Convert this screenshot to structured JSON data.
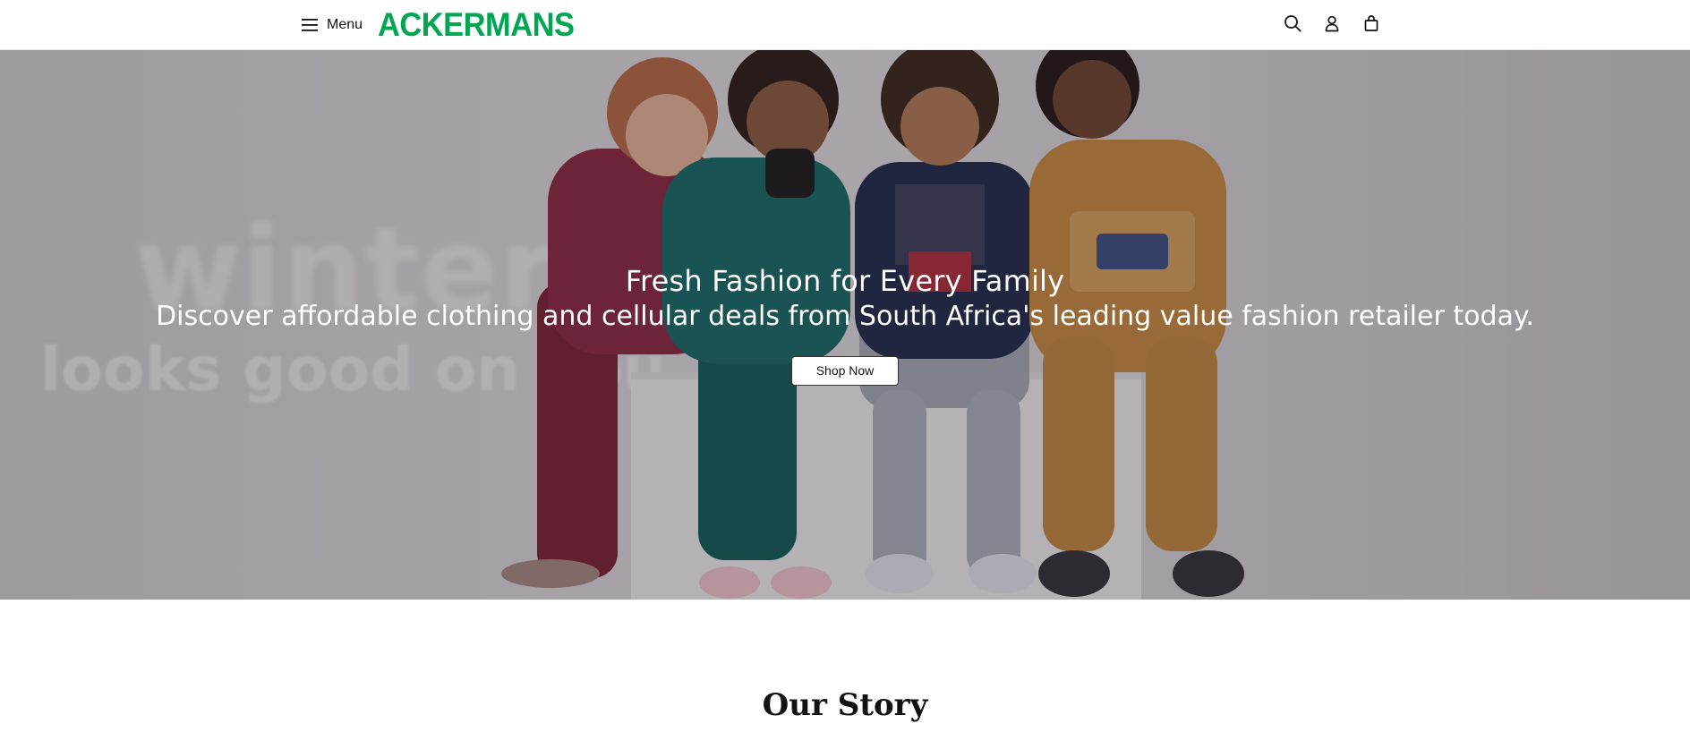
{
  "header": {
    "menu_label": "Menu",
    "logo_text": "ACKERMANS",
    "brand_color": "#00a651",
    "icons": [
      "hamburger-menu-icon",
      "search-icon",
      "account-icon",
      "shopping-bag-icon"
    ]
  },
  "hero": {
    "image_text_line1": "winter",
    "image_text_line2": "looks good on you",
    "title": "Fresh Fashion for Every Family",
    "subtitle": "Discover affordable clothing and cellular deals from South Africa's leading value fashion retailer today.",
    "cta_label": "Shop Now"
  },
  "story": {
    "title": "Our Story"
  }
}
